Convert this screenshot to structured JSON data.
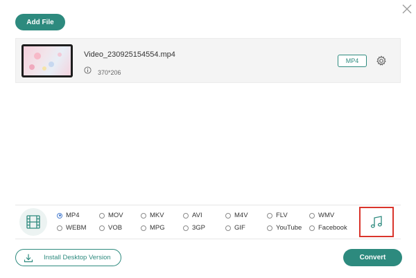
{
  "toolbar": {
    "add_file_label": "Add File",
    "close_icon": "close-icon"
  },
  "file": {
    "name": "Video_230925154554.mp4",
    "resolution": "370*206",
    "format": "MP4",
    "info_icon": "info-icon",
    "settings_icon": "gear-icon"
  },
  "formats": {
    "selected": "MP4",
    "row1": [
      "MP4",
      "MOV",
      "MKV",
      "AVI",
      "M4V",
      "FLV",
      "WMV"
    ],
    "row2": [
      "WEBM",
      "VOB",
      "MPG",
      "3GP",
      "GIF",
      "YouTube",
      "Facebook"
    ],
    "video_tab_icon": "film-icon",
    "audio_tab_icon": "music-note-icon"
  },
  "footer": {
    "install_label": "Install Desktop Version",
    "convert_label": "Convert"
  },
  "colors": {
    "accent": "#2d8a7e",
    "highlight": "#d9342b",
    "radio_selected": "#4a7fd0"
  }
}
